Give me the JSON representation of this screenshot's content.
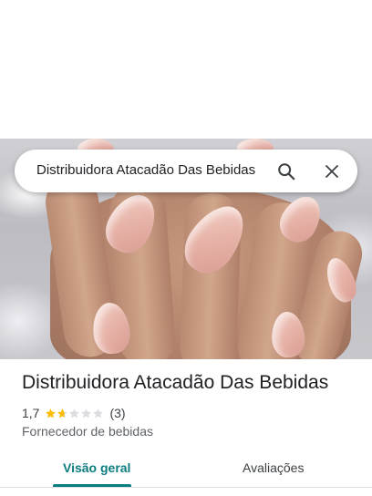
{
  "search": {
    "query": "Distribuidora Atacadão Das Bebidas",
    "search_icon": "search-icon",
    "clear_icon": "close-icon"
  },
  "place": {
    "name": "Distribuidora Atacadão Das Bebidas",
    "rating": "1,7",
    "rating_value": 1.7,
    "rating_max": 5,
    "review_count": "(3)",
    "category": "Fornecedor de bebidas"
  },
  "tabs": [
    {
      "label": "Visão geral",
      "active": true
    },
    {
      "label": "Avaliações",
      "active": false
    }
  ],
  "colors": {
    "accent": "#0b7c7f",
    "star_filled": "#fbbc04",
    "star_empty": "#dadce0"
  }
}
